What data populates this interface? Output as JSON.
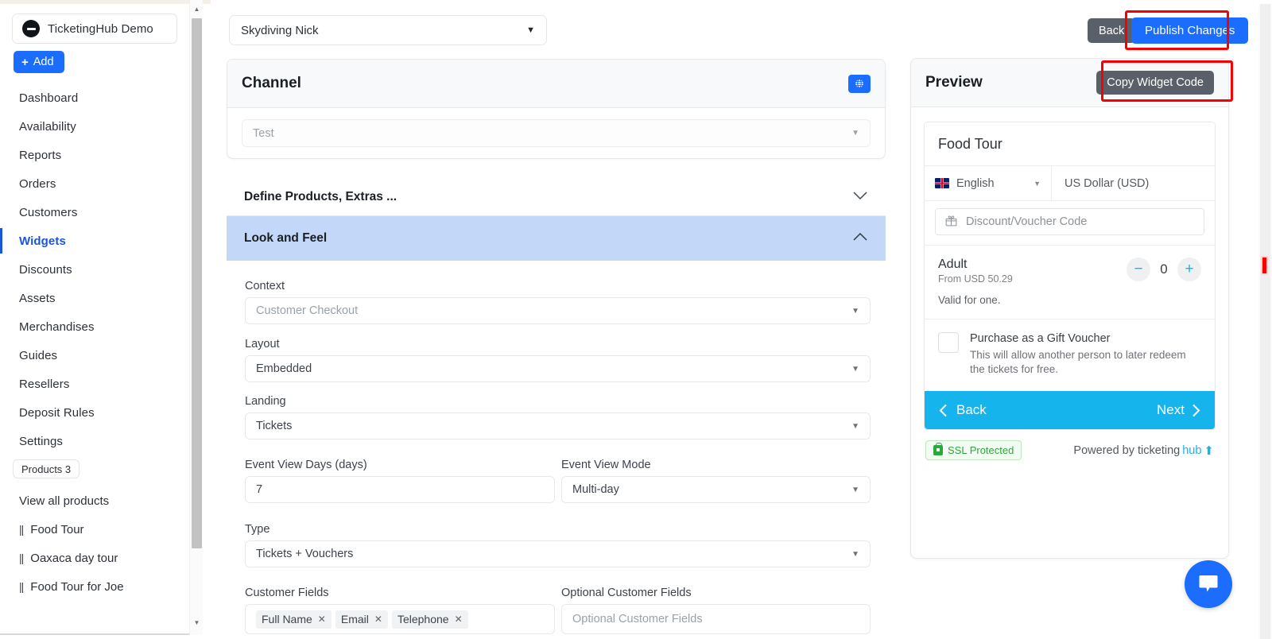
{
  "sidebar": {
    "brand": {
      "name": "TicketingHub Demo",
      "logo_icon": "ticket-circle-icon"
    },
    "add_button": {
      "label": "Add",
      "icon": "plus-icon"
    },
    "items": [
      {
        "label": "Dashboard",
        "active": false
      },
      {
        "label": "Availability",
        "active": false
      },
      {
        "label": "Reports",
        "active": false
      },
      {
        "label": "Orders",
        "active": false
      },
      {
        "label": "Customers",
        "active": false
      },
      {
        "label": "Widgets",
        "active": true
      },
      {
        "label": "Discounts",
        "active": false
      },
      {
        "label": "Assets",
        "active": false
      },
      {
        "label": "Merchandises",
        "active": false
      },
      {
        "label": "Guides",
        "active": false
      },
      {
        "label": "Resellers",
        "active": false
      },
      {
        "label": "Deposit Rules",
        "active": false
      },
      {
        "label": "Settings",
        "active": false
      }
    ],
    "products_badge": "Products 3",
    "view_all": "View all products",
    "products": [
      {
        "label": "Food Tour"
      },
      {
        "label": "Oaxaca day tour"
      },
      {
        "label": "Food Tour for Joe"
      }
    ],
    "scroll_up_icon": "chevron-up-icon",
    "scroll_down_icon": "chevron-down-icon"
  },
  "toolbar": {
    "widget_select_value": "Skydiving Nick",
    "back_label": "Back",
    "publish_label": "Publish Changes"
  },
  "channel": {
    "title": "Channel",
    "globe_icon": "globe-icon",
    "select_placeholder": "Test"
  },
  "accordions": [
    {
      "title": "Define Products, Extras ...",
      "expanded": false,
      "chevron": "chevron-down-icon"
    },
    {
      "title": "Look and Feel",
      "expanded": true,
      "chevron": "chevron-up-icon"
    }
  ],
  "look_and_feel": {
    "context": {
      "label": "Context",
      "value": "Customer Checkout"
    },
    "layout": {
      "label": "Layout",
      "value": "Embedded"
    },
    "landing": {
      "label": "Landing",
      "value": "Tickets"
    },
    "event_view_days": {
      "label": "Event View Days (days)",
      "value": "7"
    },
    "event_view_mode": {
      "label": "Event View Mode",
      "value": "Multi-day"
    },
    "type": {
      "label": "Type",
      "value": "Tickets + Vouchers"
    },
    "customer_fields": {
      "label": "Customer Fields",
      "tags": [
        "Full Name",
        "Email",
        "Telephone"
      ],
      "remove_icon": "close-x-icon"
    },
    "optional_customer_fields": {
      "label": "Optional Customer Fields",
      "placeholder": "Optional Customer Fields"
    }
  },
  "preview": {
    "title": "Preview",
    "copy_button": "Copy Widget Code",
    "widget": {
      "product_title": "Food Tour",
      "language": "English",
      "language_flag_icon": "uk-flag-icon",
      "currency": "US Dollar (USD)",
      "voucher_placeholder": "Discount/Voucher Code",
      "voucher_icon": "gift-icon",
      "ticket": {
        "name": "Adult",
        "price_from": "From  USD 50.29",
        "note": "Valid for one.",
        "quantity": "0",
        "minus_icon": "minus-icon",
        "plus_icon": "plus-icon"
      },
      "gift": {
        "title": "Purchase as a Gift Voucher",
        "subtitle": "This will allow another person to later redeem the tickets for free."
      },
      "nav": {
        "back": "Back",
        "next": "Next",
        "back_icon": "chevron-left-icon",
        "next_icon": "chevron-right-icon"
      },
      "footer": {
        "ssl": "SSL Protected",
        "ssl_icon": "lock-icon",
        "powered_prefix": "Powered by ticketing",
        "powered_brand": "hub",
        "brand_icon": "ticketinghub-bird-icon"
      }
    }
  },
  "chat": {
    "icon": "chat-bubble-icon"
  },
  "colors": {
    "accent_blue": "#1a6dff",
    "active_nav": "#1a56db",
    "accordion_active_bg": "#c3d8f8",
    "widget_cyan": "#15b4ec",
    "gray_button": "#5a6069",
    "highlight_red": "#f60000",
    "ssl_green": "#2aa93b"
  }
}
